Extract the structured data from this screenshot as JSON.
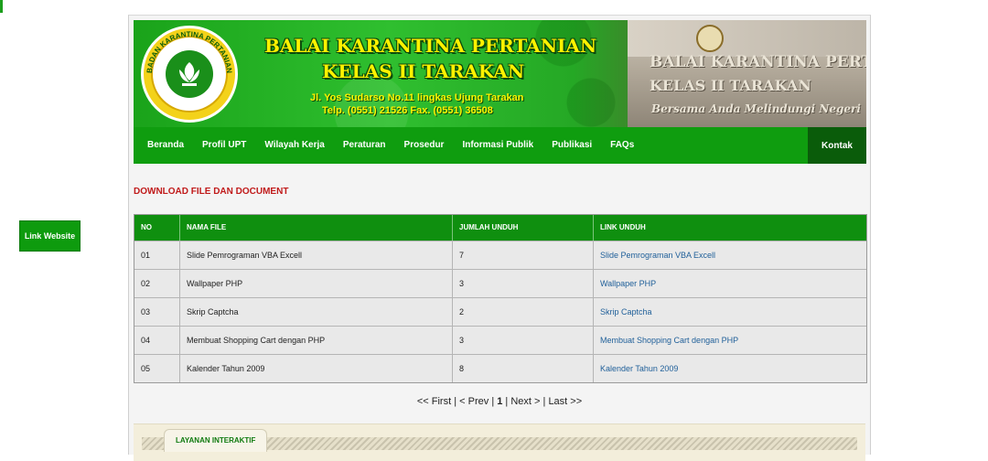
{
  "side": {
    "link_website": "Link Website"
  },
  "header": {
    "title_line1": "BALAI KARANTINA PERTANIAN",
    "title_line2": "KELAS II TARAKAN",
    "address": "Jl. Yos Sudarso No.11 lingkas Ujung Tarakan",
    "phone": "Telp. (0551) 21526  Fax. (0551) 36508",
    "logo_text": "BADAN KARANTINA PERTANIAN",
    "photo_sign_line1": "BALAI KARANTINA PERTANIAN",
    "photo_sign_line2": "KELAS II TARAKAN",
    "photo_sign_line3": "Bersama Anda Melindungi Negeri"
  },
  "nav": {
    "items": [
      "Beranda",
      "Profil UPT",
      "Wilayah Kerja",
      "Peraturan",
      "Prosedur",
      "Informasi Publik",
      "Publikasi",
      "FAQs"
    ],
    "kontak": "Kontak"
  },
  "section_title": "DOWNLOAD FILE DAN DOCUMENT",
  "table": {
    "headers": [
      "NO",
      "NAMA FILE",
      "JUMLAH UNDUH",
      "LINK UNDUH"
    ],
    "rows": [
      [
        "01",
        "Slide Pemrograman VBA Excell",
        "7",
        "Slide Pemrograman VBA Excell"
      ],
      [
        "02",
        "Wallpaper PHP",
        "3",
        "Wallpaper PHP"
      ],
      [
        "03",
        "Skrip Captcha",
        "2",
        "Skrip Captcha"
      ],
      [
        "04",
        "Membuat Shopping Cart dengan PHP",
        "3",
        "Membuat Shopping Cart dengan PHP"
      ],
      [
        "05",
        "Kalender Tahun 2009",
        "8",
        "Kalender Tahun 2009"
      ]
    ]
  },
  "pager": {
    "first": "<< First",
    "prev": "< Prev",
    "current": "1",
    "next": "Next >",
    "last": "Last >>"
  },
  "footer": {
    "tab_label": "LAYANAN INTERAKTIF"
  },
  "colors": {
    "brand_green": "#0f9d0f",
    "dark_green": "#0a5c0a",
    "title_red": "#c01a1a",
    "link_blue": "#1f5f99",
    "title_yellow": "#fff200"
  }
}
